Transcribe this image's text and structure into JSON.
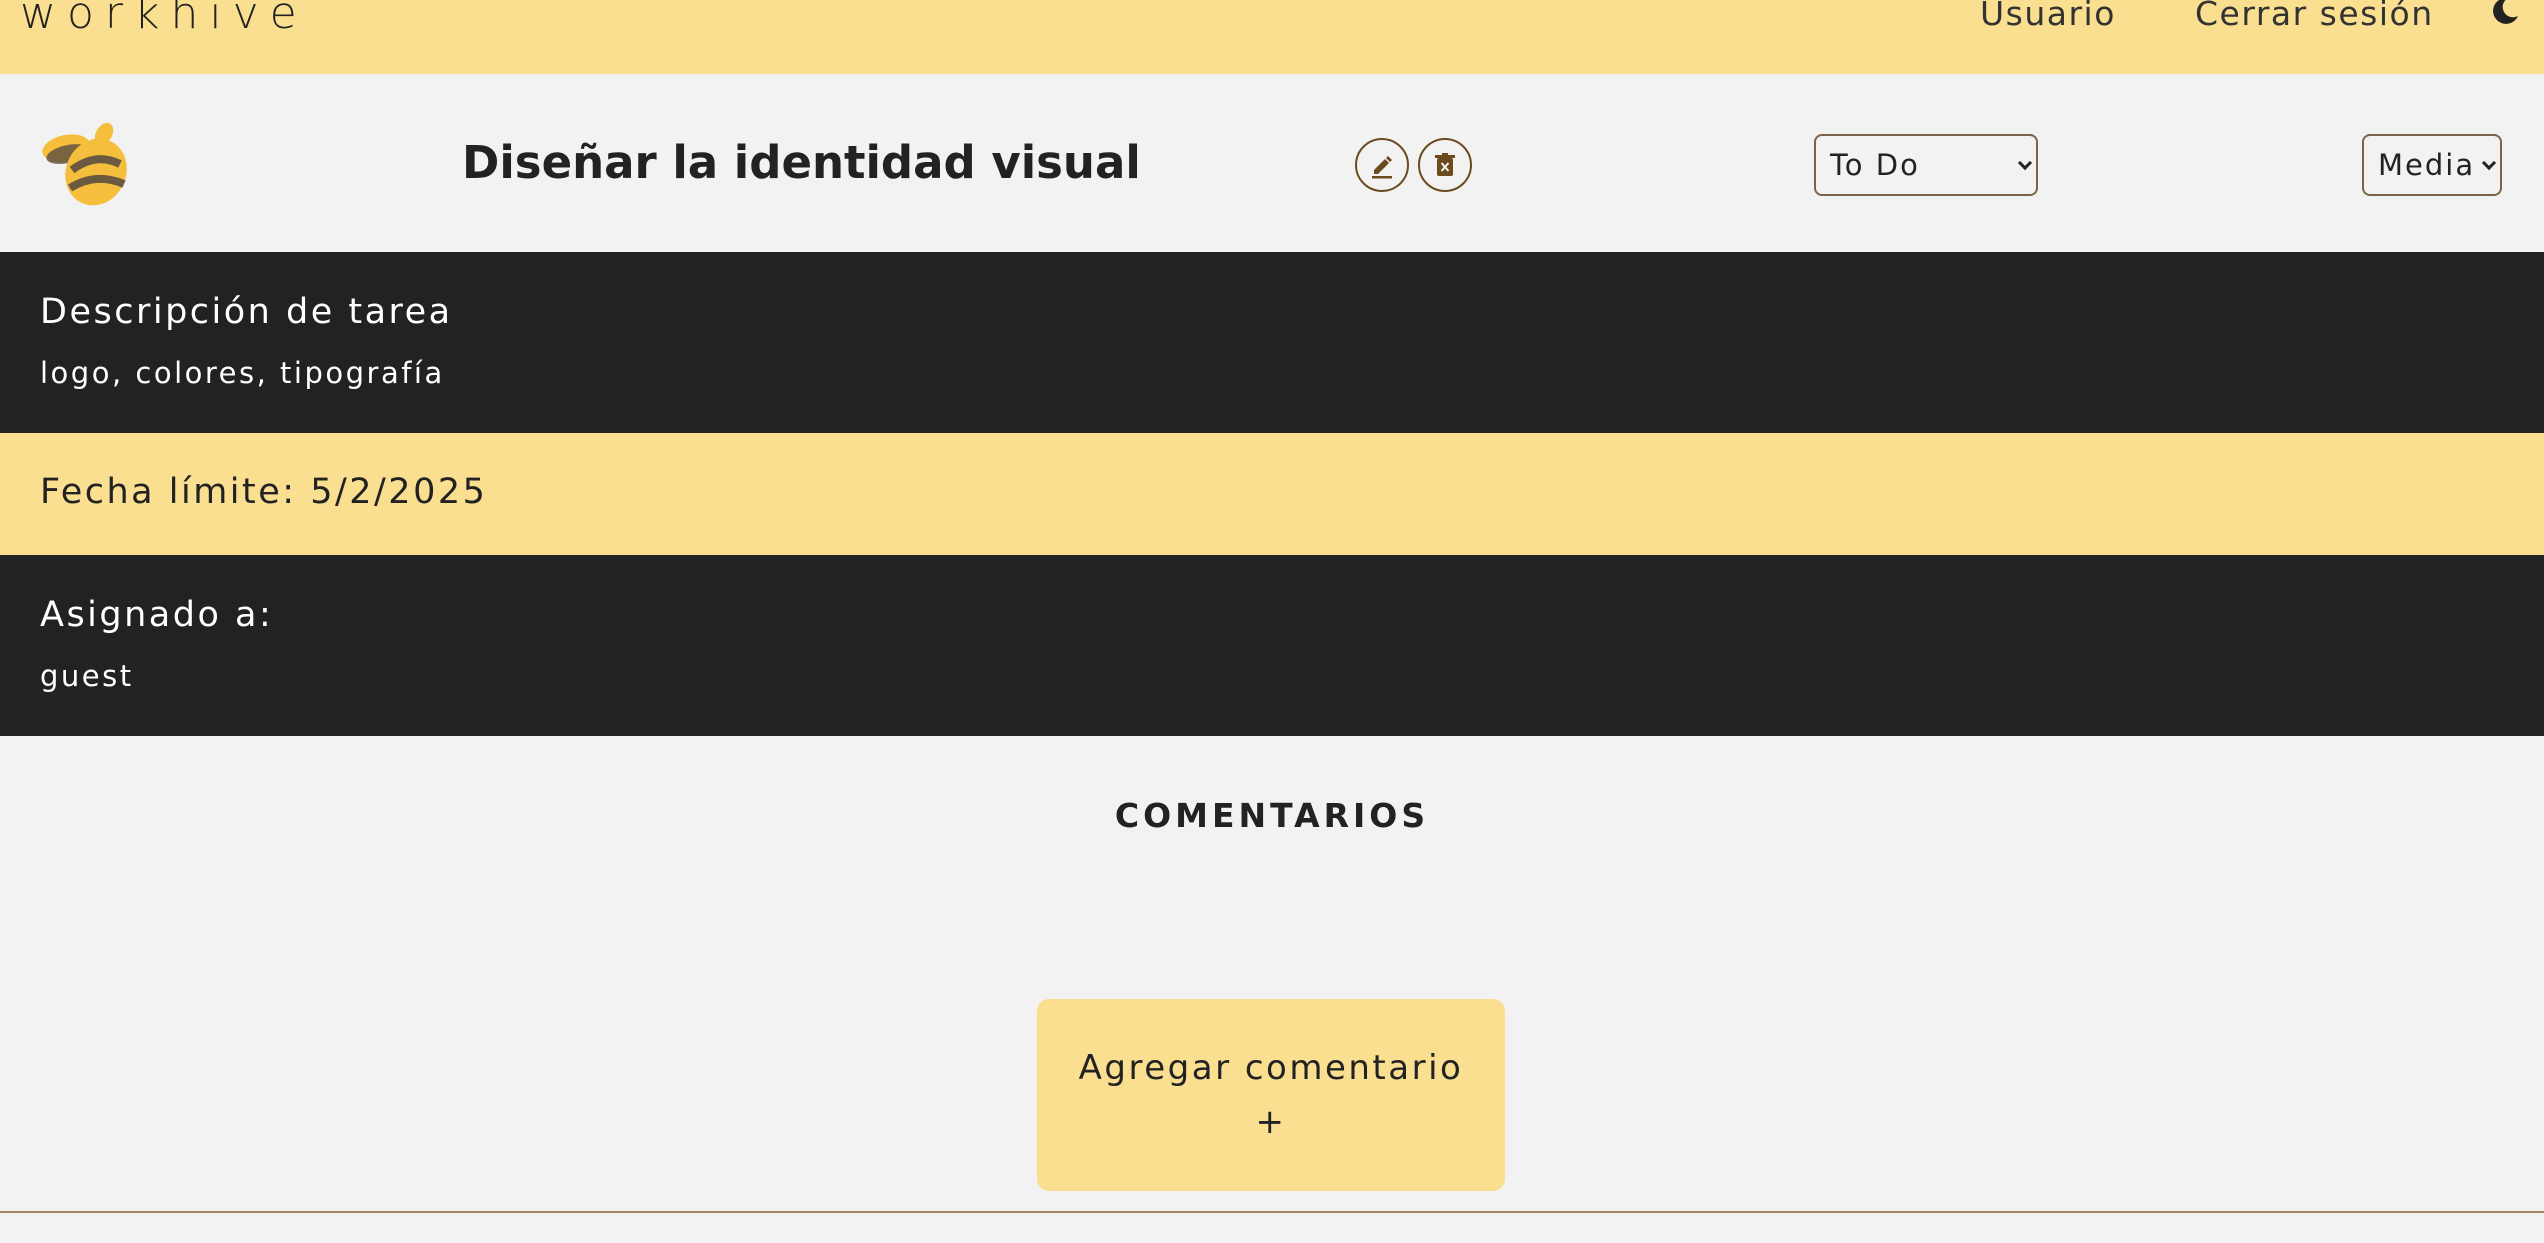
{
  "header": {
    "brand": "workhive",
    "nav": {
      "user": "Usuario",
      "logout": "Cerrar sesión"
    },
    "theme_icon": "moon-icon"
  },
  "task": {
    "logo_icon": "bee-logo",
    "title": "Diseñar la identidad visual",
    "edit_icon": "pencil-icon",
    "delete_icon": "trash-icon",
    "status": {
      "selected": "To Do"
    },
    "priority": {
      "selected": "Media"
    },
    "description": {
      "label": "Descripción de tarea",
      "value": "logo, colores, tipografía"
    },
    "deadline": "Fecha límite: 5/2/2025",
    "assigned": {
      "label": "Asignado a:",
      "value": "guest"
    }
  },
  "comments": {
    "title": "COMENTARIOS",
    "add_label": "Agregar comentario",
    "add_symbol": "+"
  },
  "colors": {
    "accent_yellow": "#f9df8f",
    "dark_band": "#222222",
    "background": "#f2f2f2",
    "brown_border": "#6b4a1e"
  }
}
